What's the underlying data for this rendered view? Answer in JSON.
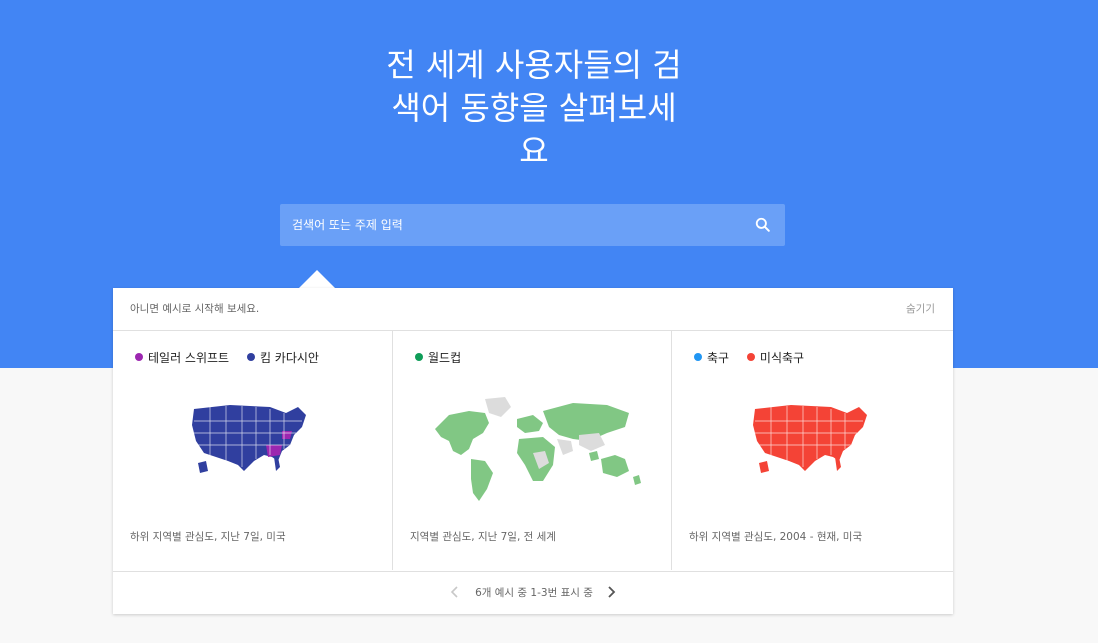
{
  "hero": {
    "headline_lines": [
      "전 세계 사용자들의 검",
      "색어 동향을 살펴보세",
      "요"
    ],
    "search_placeholder": "검색어 또는 주제 입력",
    "search_icon": "search-icon"
  },
  "examples": {
    "intro": "아니면 예시로 시작해 보세요.",
    "hide_label": "숨기기",
    "cards": [
      {
        "terms": [
          {
            "label": "테일러 스위프트",
            "color": "#9c27b0"
          },
          {
            "label": "킴 카다시안",
            "color": "#303f9f"
          }
        ],
        "caption": "하위 지역별 관심도, 지난 7일, 미국"
      },
      {
        "terms": [
          {
            "label": "월드컵",
            "color": "#0f9d58"
          }
        ],
        "caption": "지역별 관심도, 지난 7일, 전 세계"
      },
      {
        "terms": [
          {
            "label": "축구",
            "color": "#2196f3"
          },
          {
            "label": "미식축구",
            "color": "#f44336"
          }
        ],
        "caption": "하위 지역별 관심도, 2004 - 현재, 미국"
      }
    ],
    "pager": "6개 예시 중 1-3번 표시 중"
  },
  "colors": {
    "hero_bg": "#4285f4",
    "search_bg": "#6aa0f7",
    "map_blue": "#303f9f",
    "map_purple": "#9c27b0",
    "map_green": "#81c784",
    "map_red": "#f44336",
    "map_gray": "#dcdcdc"
  }
}
